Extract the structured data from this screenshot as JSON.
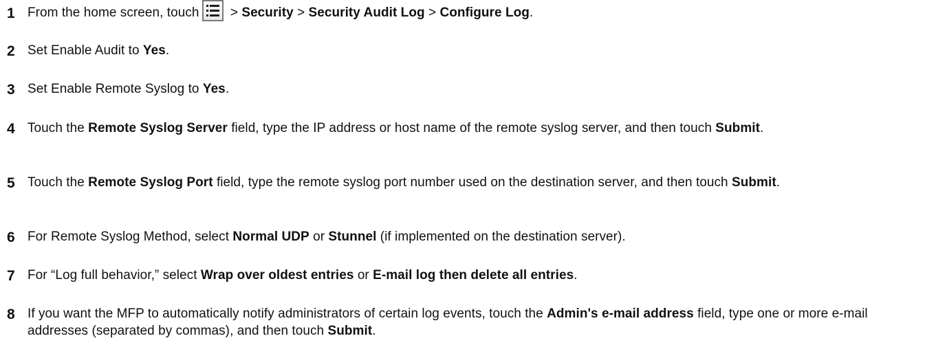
{
  "steps": [
    {
      "number": "1",
      "parts": [
        {
          "text": "From the home screen, touch"
        },
        {
          "icon": "menu-list-icon"
        },
        {
          "text": " > "
        },
        {
          "text": "Security",
          "bold": true
        },
        {
          "text": " > "
        },
        {
          "text": "Security Audit Log",
          "bold": true
        },
        {
          "text": " > "
        },
        {
          "text": "Configure Log",
          "bold": true
        },
        {
          "text": "."
        }
      ]
    },
    {
      "number": "2",
      "parts": [
        {
          "text": "Set Enable Audit to "
        },
        {
          "text": "Yes",
          "bold": true
        },
        {
          "text": "."
        }
      ]
    },
    {
      "number": "3",
      "parts": [
        {
          "text": "Set Enable Remote Syslog to "
        },
        {
          "text": "Yes",
          "bold": true
        },
        {
          "text": "."
        }
      ]
    },
    {
      "number": "4",
      "parts": [
        {
          "text": "Touch the "
        },
        {
          "text": "Remote Syslog Server",
          "bold": true
        },
        {
          "text": " field, type the IP address or host name of the remote syslog server, and then touch "
        },
        {
          "text": "Submit",
          "bold": true
        },
        {
          "text": "."
        }
      ]
    },
    {
      "number": "5",
      "parts": [
        {
          "text": "Touch the "
        },
        {
          "text": "Remote Syslog Port",
          "bold": true
        },
        {
          "text": " field, type the remote syslog port number used on the destination server, and then touch "
        },
        {
          "text": "Submit",
          "bold": true
        },
        {
          "text": "."
        }
      ]
    },
    {
      "number": "6",
      "parts": [
        {
          "text": "For Remote Syslog Method, select "
        },
        {
          "text": "Normal UDP",
          "bold": true
        },
        {
          "text": " or "
        },
        {
          "text": "Stunnel",
          "bold": true
        },
        {
          "text": " (if implemented on the destination server)."
        }
      ]
    },
    {
      "number": "7",
      "parts": [
        {
          "text": "For “Log full behavior,” select "
        },
        {
          "text": "Wrap over oldest entries",
          "bold": true
        },
        {
          "text": " or "
        },
        {
          "text": "E-mail log then delete all entries",
          "bold": true
        },
        {
          "text": "."
        }
      ]
    },
    {
      "number": "8",
      "parts": [
        {
          "text": "If you want the MFP to automatically notify administrators of certain log events, touch the "
        },
        {
          "text": "Admin's e-mail address",
          "bold": true
        },
        {
          "text": " field, type one or more e-mail addresses (separated by commas), and then touch "
        },
        {
          "text": "Submit",
          "bold": true
        },
        {
          "text": "."
        }
      ]
    }
  ]
}
